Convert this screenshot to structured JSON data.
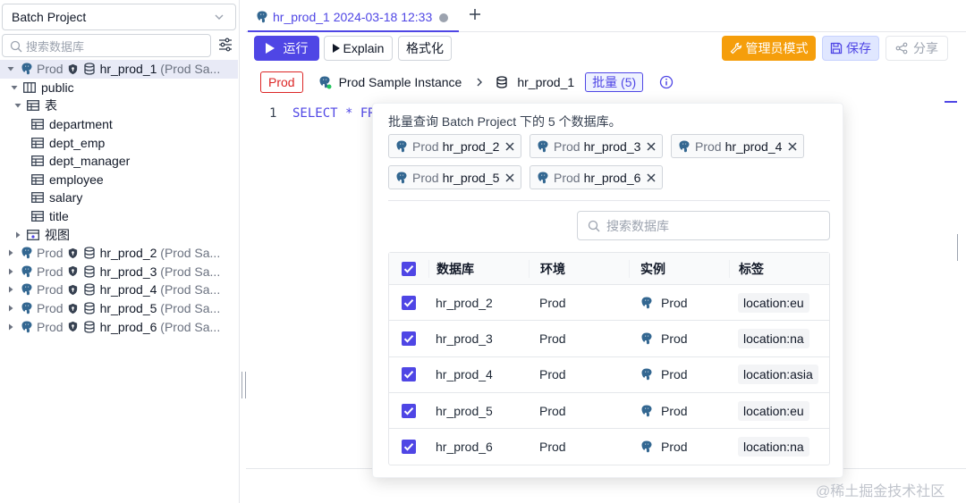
{
  "sidebar": {
    "project": "Batch Project",
    "search_placeholder": "搜索数据库",
    "tree": {
      "db1": {
        "env": "Prod",
        "name": "hr_prod_1",
        "instance": "(Prod Sa..."
      },
      "schema": "public",
      "tables_group": "表",
      "tables": [
        "department",
        "dept_emp",
        "dept_manager",
        "employee",
        "salary",
        "title"
      ],
      "views_group": "视图",
      "others": [
        {
          "env": "Prod",
          "name": "hr_prod_2",
          "instance": "(Prod Sa..."
        },
        {
          "env": "Prod",
          "name": "hr_prod_3",
          "instance": "(Prod Sa..."
        },
        {
          "env": "Prod",
          "name": "hr_prod_4",
          "instance": "(Prod Sa..."
        },
        {
          "env": "Prod",
          "name": "hr_prod_5",
          "instance": "(Prod Sa..."
        },
        {
          "env": "Prod",
          "name": "hr_prod_6",
          "instance": "(Prod Sa..."
        }
      ]
    }
  },
  "tab": {
    "title": "hr_prod_1 2024-03-18 12:33"
  },
  "toolbar": {
    "run": "运行",
    "explain": "Explain",
    "format": "格式化",
    "admin": "管理员模式",
    "save": "保存",
    "share": "分享"
  },
  "breadcrumb": {
    "env": "Prod",
    "instance": "Prod Sample Instance",
    "database": "hr_prod_1",
    "batch": "批量 (5)"
  },
  "editor": {
    "line": "1",
    "code": "SELECT * FR"
  },
  "popover": {
    "title": "批量查询 Batch Project 下的 5 个数据库。",
    "chips": [
      {
        "env": "Prod",
        "name": "hr_prod_2"
      },
      {
        "env": "Prod",
        "name": "hr_prod_3"
      },
      {
        "env": "Prod",
        "name": "hr_prod_4"
      },
      {
        "env": "Prod",
        "name": "hr_prod_5"
      },
      {
        "env": "Prod",
        "name": "hr_prod_6"
      }
    ],
    "search_placeholder": "搜索数据库",
    "columns": [
      "数据库",
      "环境",
      "实例",
      "标签"
    ],
    "rows": [
      {
        "db": "hr_prod_2",
        "env": "Prod",
        "instance": "Prod",
        "label": "location:eu"
      },
      {
        "db": "hr_prod_3",
        "env": "Prod",
        "instance": "Prod",
        "label": "location:na"
      },
      {
        "db": "hr_prod_4",
        "env": "Prod",
        "instance": "Prod",
        "label": "location:asia"
      },
      {
        "db": "hr_prod_5",
        "env": "Prod",
        "instance": "Prod",
        "label": "location:eu"
      },
      {
        "db": "hr_prod_6",
        "env": "Prod",
        "instance": "Prod",
        "label": "location:na"
      }
    ]
  },
  "watermark": "@稀土掘金技术社区",
  "colors": {
    "accent": "#4f46e5",
    "admin": "#f59e0b",
    "env_badge": "#dc2626"
  },
  "icons": [
    "postgres-icon",
    "shield-icon",
    "database-icon",
    "table-icon",
    "schema-icon",
    "view-icon",
    "search-icon",
    "filter-icon",
    "play-icon",
    "wrench-icon",
    "save-icon",
    "share-icon",
    "info-icon",
    "close-icon",
    "checkbox-icon"
  ]
}
